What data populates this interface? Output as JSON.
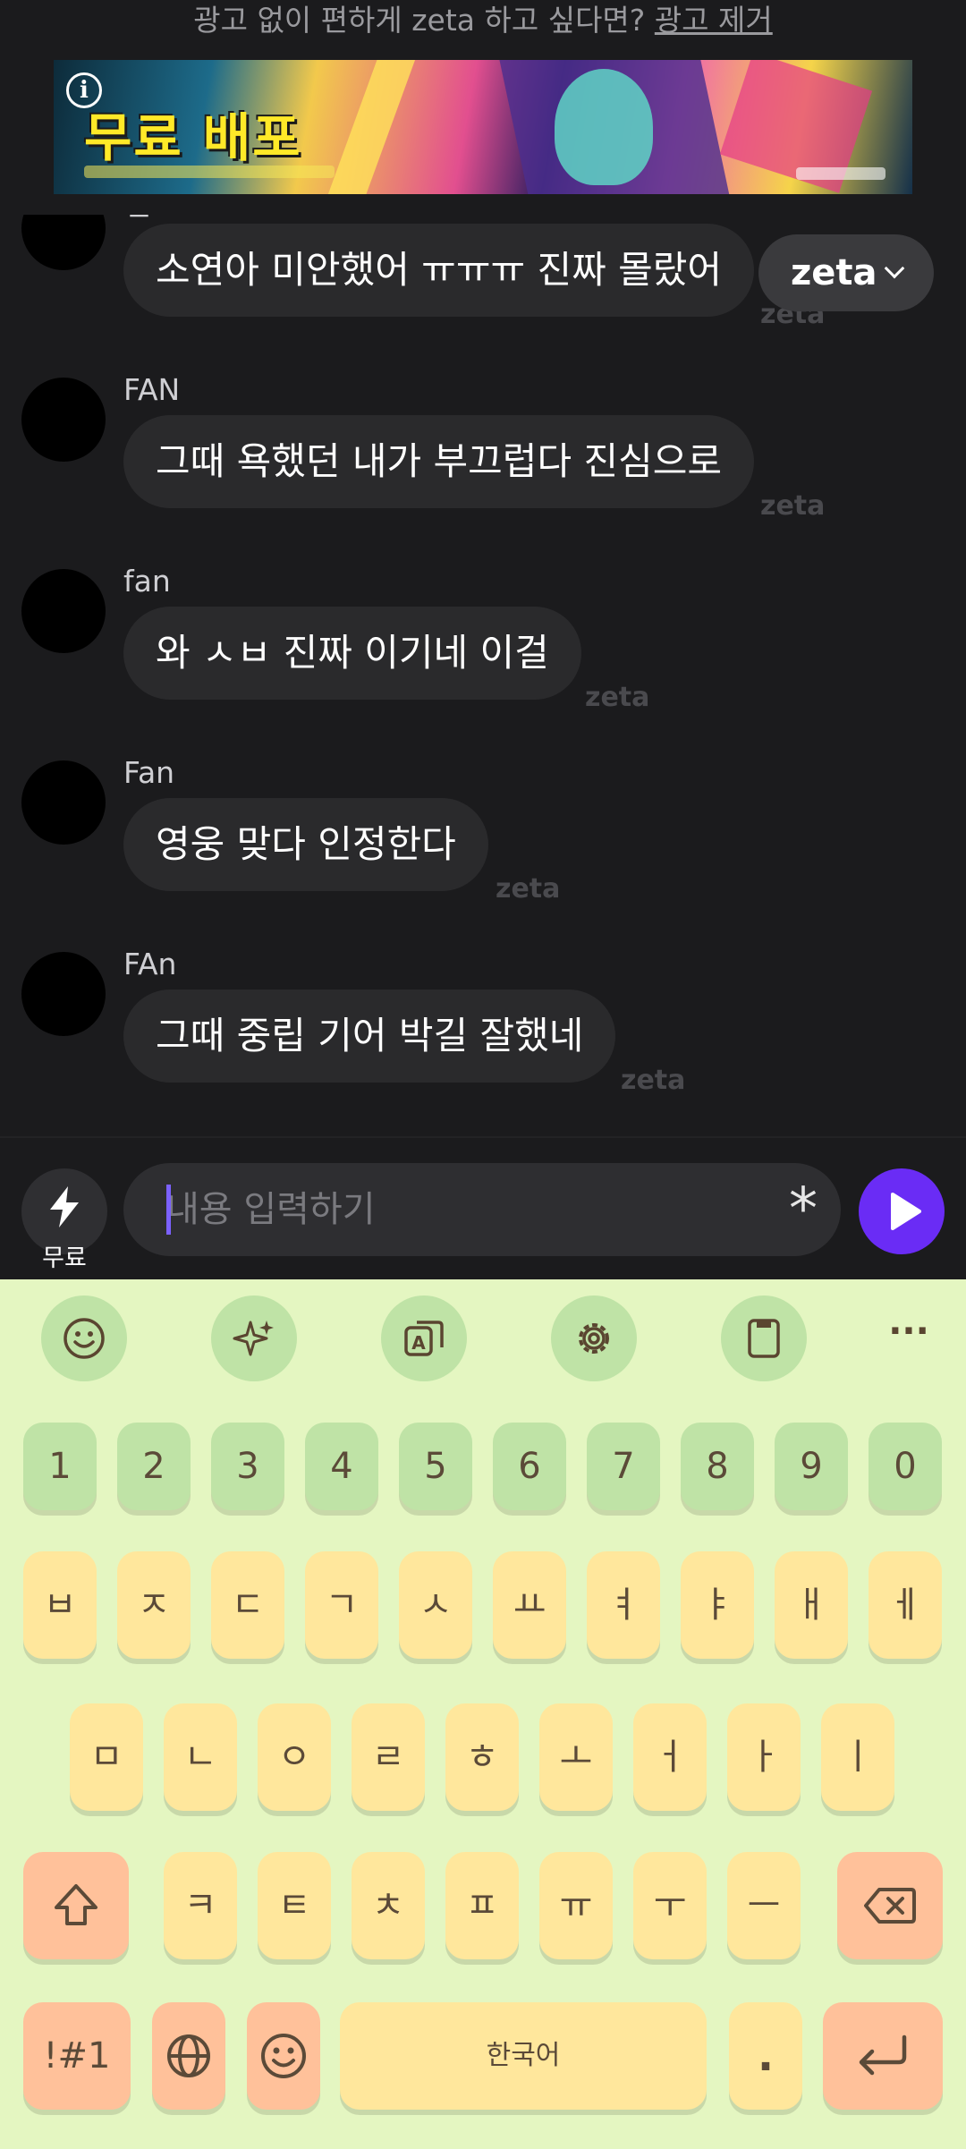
{
  "ad": {
    "top_text": "광고 없이 편하게 zeta 하고 싶다면?",
    "remove_link": "광고 제거",
    "banner_title": "무료 배포"
  },
  "chat_switcher": {
    "label": "zeta"
  },
  "messages": [
    {
      "sender": "렌",
      "text": "소연아 미안했어 ㅠㅠㅠ 진짜 몰랐어",
      "tag": "zeta"
    },
    {
      "sender": "FAN",
      "text": "그때 욕했던 내가 부끄럽다 진심으로",
      "tag": "zeta"
    },
    {
      "sender": "fan",
      "text": "와 ㅅㅂ 진짜 이기네 이걸",
      "tag": "zeta"
    },
    {
      "sender": "Fan",
      "text": "영웅 맞다 인정한다",
      "tag": "zeta"
    },
    {
      "sender": "FAn",
      "text": "그때 중립 기어 박길 잘했네",
      "tag": "zeta"
    }
  ],
  "input": {
    "boost_label": "무료",
    "placeholder": "내용 입력하기",
    "asterisk": "*"
  },
  "keyboard": {
    "toolbar_icons": [
      "emoji-icon",
      "sparkle-icon",
      "translate-icon",
      "settings-icon",
      "clipboard-icon",
      "more-icon"
    ],
    "more": "···",
    "numbers": [
      "1",
      "2",
      "3",
      "4",
      "5",
      "6",
      "7",
      "8",
      "9",
      "0"
    ],
    "row1": [
      "ㅂ",
      "ㅈ",
      "ㄷ",
      "ㄱ",
      "ㅅ",
      "ㅛ",
      "ㅕ",
      "ㅑ",
      "ㅐ",
      "ㅔ"
    ],
    "row2": [
      "ㅁ",
      "ㄴ",
      "ㅇ",
      "ㄹ",
      "ㅎ",
      "ㅗ",
      "ㅓ",
      "ㅏ",
      "ㅣ"
    ],
    "row3": [
      "ㅋ",
      "ㅌ",
      "ㅊ",
      "ㅍ",
      "ㅠ",
      "ㅜ",
      "ㅡ"
    ],
    "symbols_key": "!#1",
    "space_label": "한국어",
    "period": ".",
    "colors": {
      "green": "#bfe3a6",
      "yellow": "#ffe79c",
      "orange": "#ffc19a",
      "background": "#e4f6c1",
      "send": "#6a2cf5"
    }
  }
}
